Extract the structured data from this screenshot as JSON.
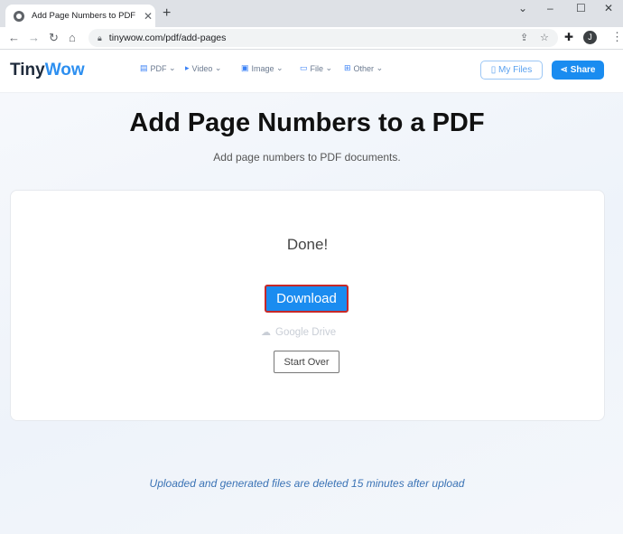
{
  "browser": {
    "tab_title": "Add Page Numbers to PDF Free",
    "tab_close": "✕",
    "new_tab": "+",
    "url": "tinywow.com/pdf/add-pages",
    "avatar_initial": "J",
    "window_controls": [
      "⌄",
      "–",
      "☐",
      "✕"
    ]
  },
  "site": {
    "logo_tiny": "Tiny",
    "logo_wow": "Wow",
    "menu": [
      {
        "label": "PDF",
        "icon": "document-icon"
      },
      {
        "label": "Video",
        "icon": "video-icon"
      },
      {
        "label": "Image",
        "icon": "image-icon"
      },
      {
        "label": "File",
        "icon": "folder-icon"
      },
      {
        "label": "Other",
        "icon": "grid-icon"
      }
    ],
    "my_files": "My Files",
    "share": "Share"
  },
  "main": {
    "title": "Add Page Numbers to a PDF",
    "subtitle": "Add page numbers to PDF documents.",
    "status": "Done!",
    "download": "Download",
    "google_drive": "Google Drive",
    "start_over": "Start Over",
    "note": "Uploaded and generated files are deleted 15 minutes after upload"
  },
  "colors": {
    "accent": "#1a8cf0",
    "highlight_border": "#c62828",
    "note_text": "#3b73b5"
  }
}
